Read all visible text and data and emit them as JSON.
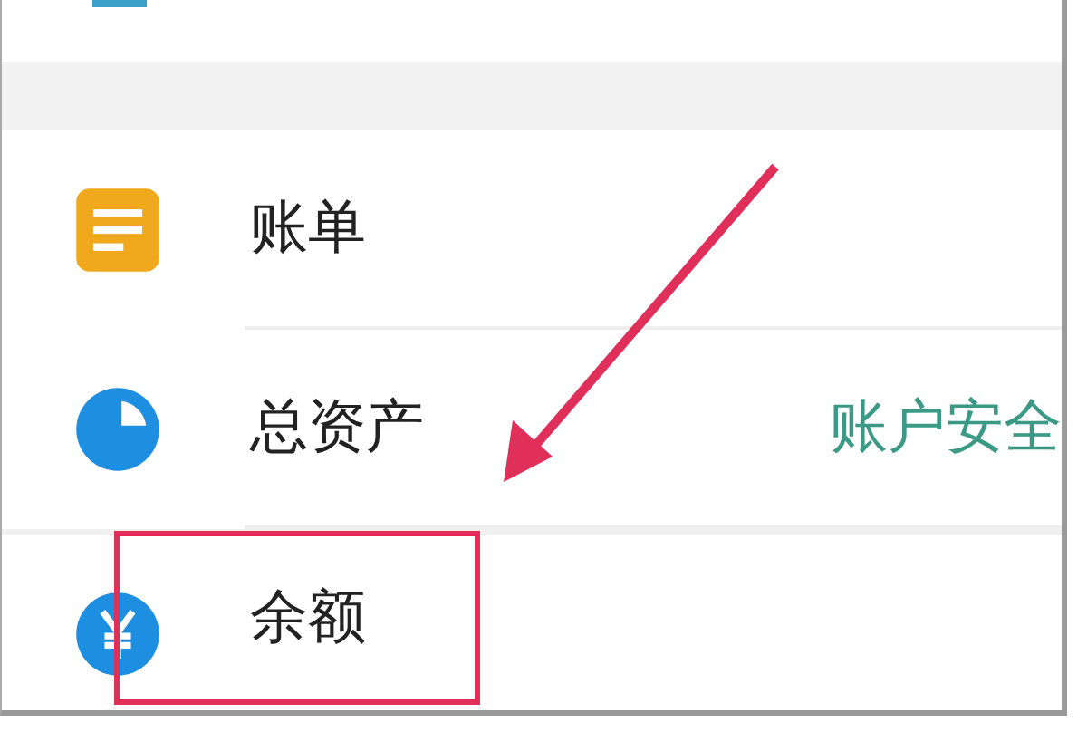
{
  "rows": [
    {
      "kind": "bill",
      "label": "账单",
      "note": "",
      "highlighted": false
    },
    {
      "kind": "assets",
      "label": "总资产",
      "note": "账户安全",
      "highlighted": false
    },
    {
      "kind": "balance",
      "label": "余额",
      "note": "",
      "highlighted": true
    }
  ]
}
